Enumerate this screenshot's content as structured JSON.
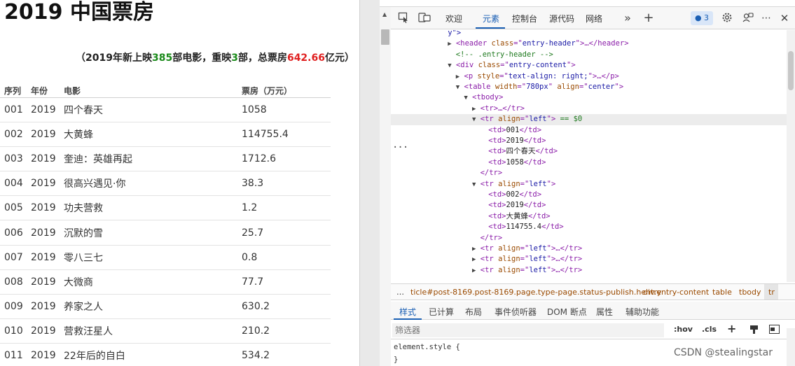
{
  "page": {
    "title": "2019 中国票房",
    "summary": {
      "prefix": "（2019年新上映",
      "new_count": "385",
      "mid1": "部电影，重映",
      "re_count": "3",
      "mid2": "部，总票房",
      "total": "642.66",
      "suffix": "亿元）"
    },
    "table": {
      "headers": [
        "序列",
        "年份",
        "电影",
        "票房（万元）"
      ],
      "rows": [
        [
          "001",
          "2019",
          "四个春天",
          "1058"
        ],
        [
          "002",
          "2019",
          "大黄蜂",
          "114755.4"
        ],
        [
          "003",
          "2019",
          "奎迪：英雄再起",
          "1712.6"
        ],
        [
          "004",
          "2019",
          "很高兴遇见·你",
          "38.3"
        ],
        [
          "005",
          "2019",
          "功夫营救",
          "1.2"
        ],
        [
          "006",
          "2019",
          "沉默的雪",
          "25.7"
        ],
        [
          "007",
          "2019",
          "零八三七",
          "0.8"
        ],
        [
          "008",
          "2019",
          "大微商",
          "77.7"
        ],
        [
          "009",
          "2019",
          "养家之人",
          "630.2"
        ],
        [
          "010",
          "2019",
          "营救汪星人",
          "210.2"
        ],
        [
          "011",
          "2019",
          "22年后的自白",
          "534.2"
        ]
      ]
    }
  },
  "devtools": {
    "tabs": [
      "欢迎",
      "元素",
      "控制台",
      "源代码",
      "网络"
    ],
    "active_tab": "元素",
    "issues_count": "3",
    "dom_lines": [
      {
        "indent": 7,
        "tri": "",
        "html": "y\">",
        "kind": "val"
      },
      {
        "indent": 7,
        "tri": "▶",
        "tag": "header",
        "attrs": [
          [
            "class",
            "entry-header"
          ]
        ],
        "tail": "…</header>"
      },
      {
        "indent": 8,
        "tri": "",
        "comment": "<!-- .entry-header -->"
      },
      {
        "indent": 7,
        "tri": "▼",
        "tag": "div",
        "attrs": [
          [
            "class",
            "entry-content"
          ]
        ],
        "tail": ""
      },
      {
        "indent": 8,
        "tri": "▶",
        "tag": "p",
        "attrs": [
          [
            "style",
            "text-align: right;"
          ]
        ],
        "tail": "…</p>"
      },
      {
        "indent": 8,
        "tri": "▼",
        "tag": "table",
        "attrs": [
          [
            "width",
            "780px"
          ],
          [
            "align",
            "center"
          ]
        ],
        "tail": ""
      },
      {
        "indent": 9,
        "tri": "▼",
        "tag": "tbody",
        "attrs": [],
        "tail": ""
      },
      {
        "indent": 10,
        "tri": "▶",
        "tag": "tr",
        "attrs": [],
        "tail": "…</tr>"
      },
      {
        "indent": 10,
        "tri": "▼",
        "tag": "tr",
        "attrs": [
          [
            "align",
            "left"
          ]
        ],
        "tail": " == $0",
        "selected": true
      },
      {
        "indent": 12,
        "tri": "",
        "td": "001"
      },
      {
        "indent": 12,
        "tri": "",
        "td": "2019"
      },
      {
        "indent": 12,
        "tri": "",
        "td": "四个春天"
      },
      {
        "indent": 12,
        "tri": "",
        "td": "1058"
      },
      {
        "indent": 11,
        "tri": "",
        "close": "</tr>"
      },
      {
        "indent": 10,
        "tri": "▼",
        "tag": "tr",
        "attrs": [
          [
            "align",
            "left"
          ]
        ],
        "tail": ""
      },
      {
        "indent": 12,
        "tri": "",
        "td": "002"
      },
      {
        "indent": 12,
        "tri": "",
        "td": "2019"
      },
      {
        "indent": 12,
        "tri": "",
        "td": "大黄蜂"
      },
      {
        "indent": 12,
        "tri": "",
        "td": "114755.4"
      },
      {
        "indent": 11,
        "tri": "",
        "close": "</tr>"
      },
      {
        "indent": 10,
        "tri": "▶",
        "tag": "tr",
        "attrs": [
          [
            "align",
            "left"
          ]
        ],
        "tail": "…</tr>"
      },
      {
        "indent": 10,
        "tri": "▶",
        "tag": "tr",
        "attrs": [
          [
            "align",
            "left"
          ]
        ],
        "tail": "…</tr>"
      },
      {
        "indent": 10,
        "tri": "▶",
        "tag": "tr",
        "attrs": [
          [
            "align",
            "left"
          ]
        ],
        "tail": "…</tr>"
      }
    ],
    "breadcrumbs": [
      "…",
      "ticle#post-8169.post-8169.page.type-page.status-publish.hentry",
      "div.entry-content",
      "table",
      "tbody",
      "tr"
    ],
    "style_tabs": [
      "样式",
      "已计算",
      "布局",
      "事件侦听器",
      "DOM 断点",
      "属性",
      "辅助功能"
    ],
    "filter_placeholder": "筛选器",
    "filter_tools": [
      ":hov",
      ".cls"
    ],
    "styles_lines": [
      "element.style {",
      "}"
    ]
  },
  "watermark": "CSDN @stealingstar",
  "colors": {
    "accent": "#1a5fb4",
    "green": "#1a8a1a",
    "red": "#e02020"
  }
}
